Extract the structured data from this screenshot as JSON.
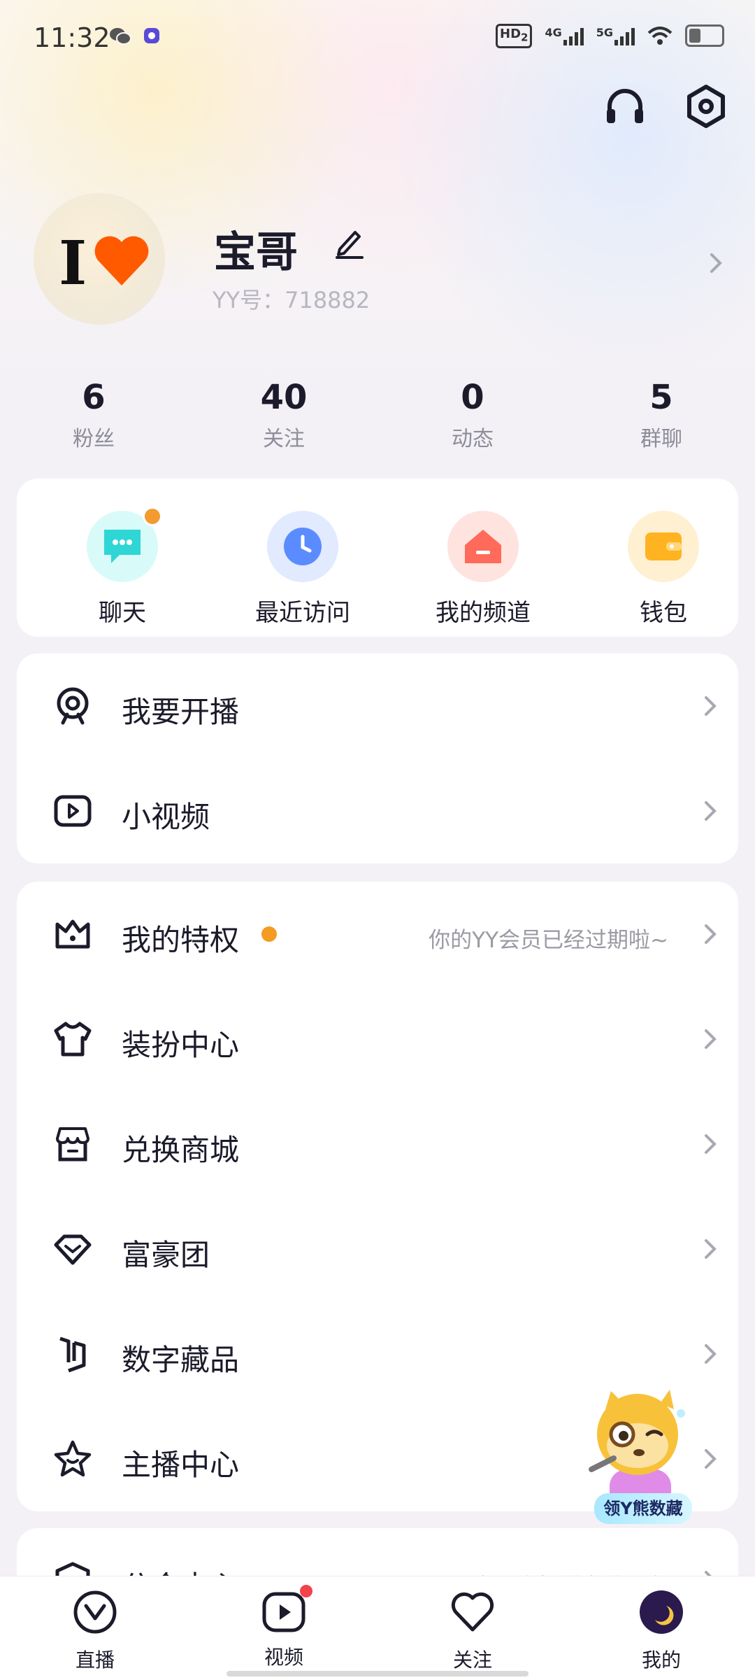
{
  "status_bar": {
    "time": "11:32",
    "hd_badge": "HD",
    "hd_sub": "2",
    "net_4g": "4G",
    "net_5g": "5G"
  },
  "profile": {
    "name": "宝哥",
    "yy_id": "YY号：718882",
    "avatar_text": "I"
  },
  "stats": [
    {
      "value": "6",
      "label": "粉丝"
    },
    {
      "value": "40",
      "label": "关注"
    },
    {
      "value": "0",
      "label": "动态"
    },
    {
      "value": "5",
      "label": "群聊"
    }
  ],
  "quick_actions": [
    {
      "label": "聊天",
      "icon": "chat-bubble-icon",
      "color": "#2fd6d6"
    },
    {
      "label": "最近访问",
      "icon": "clock-icon",
      "color": "#5b8cff"
    },
    {
      "label": "我的频道",
      "icon": "house-icon",
      "color": "#ff6a5a"
    },
    {
      "label": "钱包",
      "icon": "wallet-icon",
      "color": "#ffb320"
    }
  ],
  "menu_group_1": [
    {
      "label": "我要开播",
      "icon": "webcam-icon"
    },
    {
      "label": "小视频",
      "icon": "video-play-icon"
    }
  ],
  "menu_group_2": [
    {
      "label": "我的特权",
      "icon": "crown-icon",
      "hint": "你的YY会员已经过期啦~"
    },
    {
      "label": "装扮中心",
      "icon": "tshirt-icon"
    },
    {
      "label": "兑换商城",
      "icon": "store-icon"
    },
    {
      "label": "富豪团",
      "icon": "diamond-icon"
    },
    {
      "label": "数字藏品",
      "icon": "collection-icon"
    },
    {
      "label": "主播中心",
      "icon": "star-icon"
    }
  ],
  "menu_group_3_partial": {
    "label": "公会中心",
    "hint": "为公会提供专业服务"
  },
  "mascot": {
    "label": "领Y熊数藏"
  },
  "bottom_nav": [
    {
      "label": "直播",
      "icon": "live-icon"
    },
    {
      "label": "视频",
      "icon": "video-icon"
    },
    {
      "label": "关注",
      "icon": "heart-icon"
    },
    {
      "label": "我的",
      "icon": "avatar-icon"
    }
  ],
  "colors": {
    "accent_orange": "#f59a22",
    "badge_red": "#f2424b",
    "text_primary": "#1b1b2b",
    "text_secondary": "#8d8d99"
  }
}
